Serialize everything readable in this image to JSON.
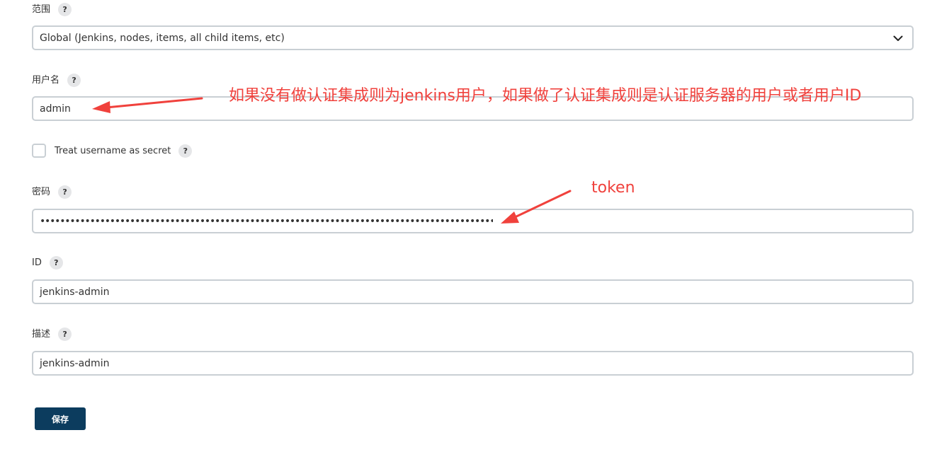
{
  "form": {
    "scope": {
      "label": "范围",
      "help": "?",
      "value": "Global (Jenkins, nodes, items, all child items, etc)"
    },
    "username": {
      "label": "用户名",
      "help": "?",
      "value": "admin"
    },
    "treat_secret": {
      "label": "Treat username as secret",
      "help": "?",
      "checked": false
    },
    "password": {
      "label": "密码",
      "help": "?",
      "value": "••••••••••••••••••••••••••••••••••••••••••••••••••••••••••••••••••••••••••••••••••••••••••••••••"
    },
    "id": {
      "label": "ID",
      "help": "?",
      "value": "jenkins-admin"
    },
    "description": {
      "label": "描述",
      "help": "?",
      "value": "jenkins-admin"
    },
    "save_label": "保存"
  },
  "annotations": {
    "username_note": "如果没有做认证集成则为jenkins用户，如果做了认证集成则是认证服务器的用户或者用户ID",
    "password_note": "token",
    "color": "#f0413c"
  },
  "colors": {
    "save_button": "#0c3c5e",
    "input_border": "#c9cfd4",
    "help_badge": "#e5e6e8"
  }
}
